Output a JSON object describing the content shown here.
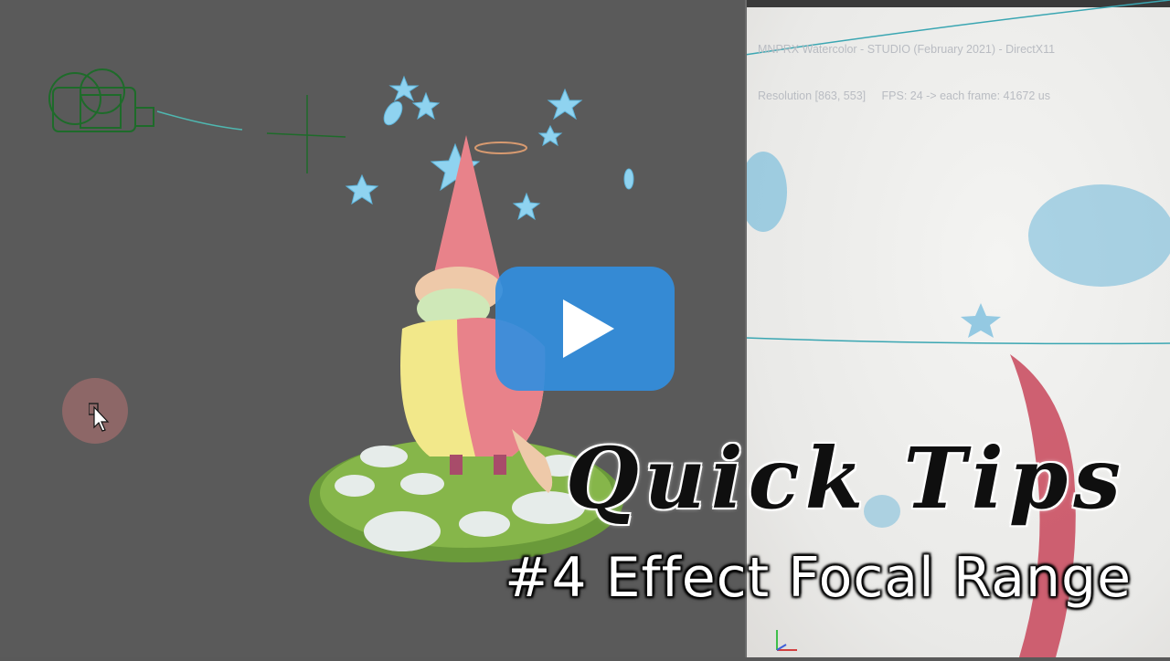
{
  "render_view": {
    "info_line1": "MNPRX Watercolor - STUDIO (February 2021) - DirectX11",
    "info_line2": "Resolution [863, 553]     FPS: 24 -> each frame: 41672 us"
  },
  "overlay": {
    "title": "Quick Tips",
    "subtitle": "#4 Effect Focal Range"
  },
  "colors": {
    "viewport_bg": "#5a5a5a",
    "play_button": "#328ede",
    "camera_wire": "#1e6b2a",
    "star_blue": "#8fd3f0",
    "gnome_hat": "#e8828a",
    "gnome_body": "#f2e88a"
  },
  "icons": {
    "play": "play-icon",
    "camera": "camera-icon",
    "cursor": "cursor-icon",
    "axis": "axis-gizmo-icon"
  }
}
